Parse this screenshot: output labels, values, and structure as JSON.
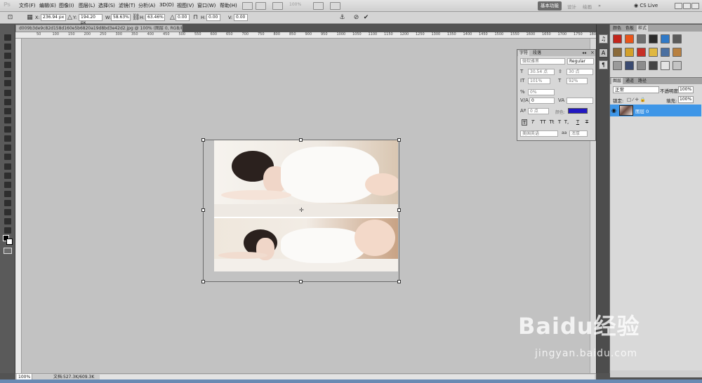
{
  "menubar": {
    "logo": "Ps",
    "items": [
      "文件(F)",
      "编辑(E)",
      "图像(I)",
      "图层(L)",
      "选择(S)",
      "滤镜(T)",
      "分析(A)",
      "3D(D)",
      "视图(V)",
      "窗口(W)",
      "帮助(H)"
    ],
    "zoom": "100%",
    "workspace_active": "基本功能",
    "workspace_items": [
      "设计",
      "绘画"
    ],
    "cs_live": "CS Live"
  },
  "options": {
    "x_label": "X:",
    "x_value": "236.94 px",
    "y_label": "Y:",
    "y_value": "194.20 px",
    "w_label": "W:",
    "w_value": "58.63%",
    "h_label": "H:",
    "h_value": "63.46%",
    "rot_value": "0.00",
    "hskew_label": "H:",
    "hskew_value": "0.00",
    "vskew_label": "V:",
    "vskew_value": "0.00"
  },
  "document": {
    "tab_title": "d009b3de9c82d158d160e5b6820a19d8bd3e42d2.jpg @ 100% (图层 0, RGB/8#) *",
    "ruler_ticks": [
      "50",
      "100",
      "150",
      "200",
      "250",
      "300",
      "350",
      "400",
      "450",
      "500",
      "550",
      "600",
      "650",
      "700",
      "750",
      "800",
      "850",
      "900",
      "950",
      "1000",
      "1050",
      "1100",
      "1150",
      "1200",
      "1250",
      "1300",
      "1350",
      "1400",
      "1450",
      "1500",
      "1550",
      "1600",
      "1650",
      "1700",
      "1750",
      "1800"
    ]
  },
  "character": {
    "tabs": [
      "字符",
      "段落"
    ],
    "font_family": "微软雅黑",
    "font_style": "Regular",
    "font_size": "30.54 点",
    "leading": "30 点",
    "vscale": "101%",
    "hscale": "92%",
    "tracking_pct": "0%",
    "tracking": "0",
    "baseline": "0 点",
    "color_label": "颜色:",
    "color": "#2218c2",
    "language": "美国英语",
    "aa": "浑厚",
    "style_buttons": [
      "T",
      "T",
      "TT",
      "Tt",
      "T",
      "T,",
      "T",
      "T"
    ]
  },
  "swatches": {
    "tabs": [
      "颜色",
      "色板",
      "样式"
    ],
    "colors": [
      "#c3251c",
      "#e9541a",
      "#6e6e6e",
      "#2b2b2b",
      "#2f79c7",
      "#5a5a5a",
      "#8a6a3a",
      "#d3a02a",
      "#c63026",
      "#e0b840",
      "#4a6fa0",
      "#b88040",
      "#9a9a9a",
      "#3a4a70",
      "#8c8c8c",
      "#444444",
      "#e3e3e3",
      "#c4c4c4"
    ]
  },
  "layers": {
    "tabs": [
      "图层",
      "通道",
      "路径"
    ],
    "blend_mode": "正常",
    "opacity_label": "不透明度:",
    "opacity": "100%",
    "lock_label": "锁定:",
    "fill_label": "填充:",
    "fill": "100%",
    "layer_name": "图层 0"
  },
  "status": {
    "zoom": "100%",
    "doc_size": "文档:527.3K/609.3K"
  },
  "watermark": {
    "logo": "Baidu经验",
    "url": "jingyan.baidu.com"
  }
}
